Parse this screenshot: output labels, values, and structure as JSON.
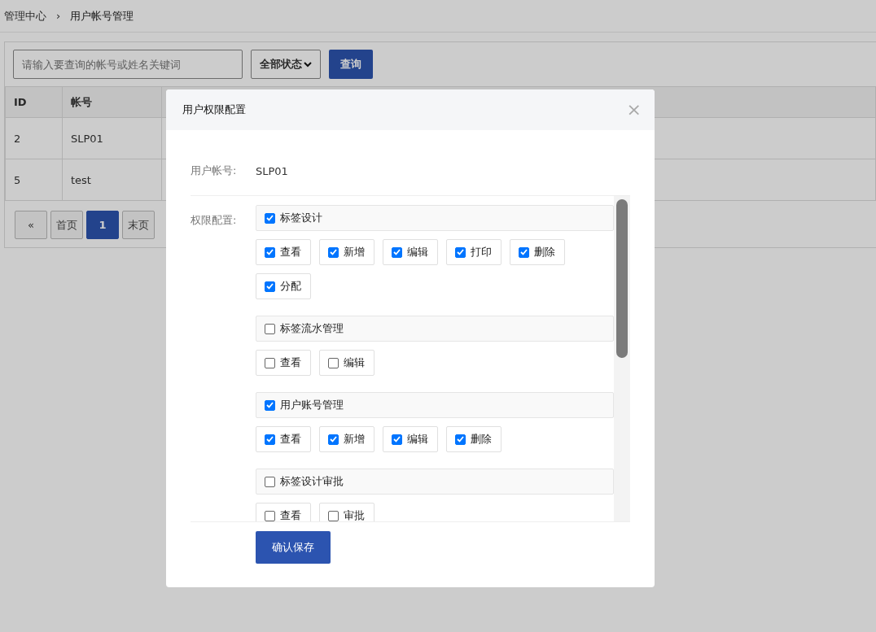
{
  "breadcrumb": [
    {
      "label": "管理中心"
    },
    {
      "label": "用户帐号管理"
    }
  ],
  "breadcrumb_separator": "›",
  "search": {
    "placeholder": "请输入要查询的帐号或姓名关键词"
  },
  "status_filter": {
    "value": "全部状态"
  },
  "query_button": "查询",
  "table": {
    "columns": [
      "ID",
      "帐号"
    ],
    "rows": [
      [
        "2",
        "SLP01"
      ],
      [
        "5",
        "test"
      ]
    ]
  },
  "pagination": [
    {
      "label": "«",
      "selected": false
    },
    {
      "label": "首页",
      "selected": false
    },
    {
      "label": "1",
      "selected": true
    },
    {
      "label": "末页",
      "selected": false
    }
  ],
  "modal": {
    "title": "用户权限配置",
    "close": "×",
    "account_label": "用户帐号:",
    "account_value": "SLP01",
    "permissions_label": "权限配置:",
    "groups": [
      {
        "label": "标签设计",
        "checked": true,
        "children": [
          {
            "label": "查看",
            "checked": true
          },
          {
            "label": "新增",
            "checked": true
          },
          {
            "label": "编辑",
            "checked": true
          },
          {
            "label": "打印",
            "checked": true
          },
          {
            "label": "删除",
            "checked": true
          },
          {
            "label": "分配",
            "checked": true
          }
        ]
      },
      {
        "label": "标签流水管理",
        "checked": false,
        "children": [
          {
            "label": "查看",
            "checked": false
          },
          {
            "label": "编辑",
            "checked": false
          }
        ]
      },
      {
        "label": "用户账号管理",
        "checked": true,
        "children": [
          {
            "label": "查看",
            "checked": true
          },
          {
            "label": "新增",
            "checked": true
          },
          {
            "label": "编辑",
            "checked": true
          },
          {
            "label": "删除",
            "checked": true
          }
        ]
      },
      {
        "label": "标签设计审批",
        "checked": false,
        "children": [
          {
            "label": "查看",
            "checked": false
          },
          {
            "label": "审批",
            "checked": false
          }
        ]
      }
    ],
    "save_button": "确认保存"
  }
}
